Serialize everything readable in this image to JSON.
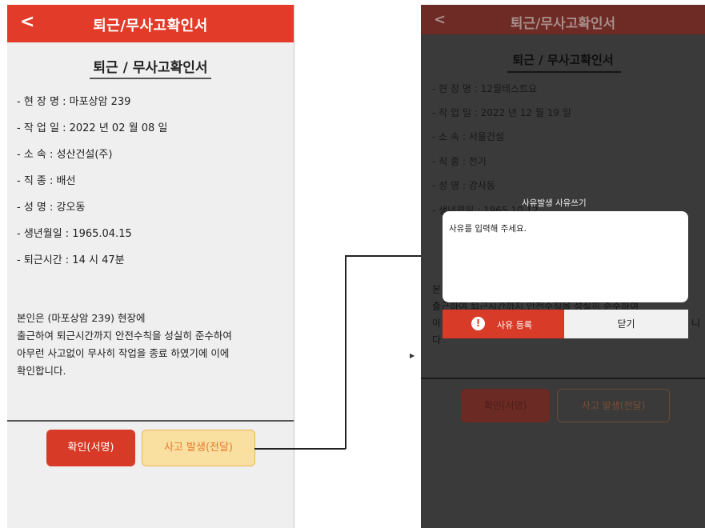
{
  "left_screen": {
    "header": {
      "back_icon": "<",
      "title": "퇴근/무사고확인서"
    },
    "document_title": "퇴근 / 무사고확인서",
    "fields": [
      "- 현  장  명 : 마포상암 239",
      "- 작  업  일 : 2022 년 02 월 08 일",
      "- 소      속 : 성산건설(주)",
      "- 직      종 : 배선",
      "- 성      명 : 강오동",
      "- 생년월일 : 1965.04.15",
      "- 퇴근시간 : 14 시  47분"
    ],
    "paragraph": [
      "본인은 (마포상암 239) 현장에",
      "출근하여 퇴근시간까지 안전수칙을 성실히 준수하여",
      "아무런 사고없이 무사히 작업을 종료 하였기에 이에",
      "확인합니다."
    ],
    "buttons": {
      "confirm": "확인(서명)",
      "accident": "사고 발생(전달)"
    }
  },
  "right_screen": {
    "header": {
      "back_icon": "<",
      "title": "퇴근/무사고확인서"
    },
    "document_title": "퇴근 / 무사고확인서",
    "fields": [
      "- 현  장  명 : 12월테스트요",
      "- 작  업  일 : 2022 년 12 월 19 일",
      "- 소      속 : 서울건설",
      "- 직      종 : 전기",
      "- 성      명 : 강사동",
      "- 생년월일 : 1965.10.12"
    ],
    "paragraph": [
      "본",
      "출근하여 퇴근시간까지 안전수칙을 성실히 준수하여",
      "아",
      "다"
    ],
    "paragraph_tail": "니",
    "buttons": {
      "confirm": "확인(서명)",
      "accident": "사고 발생(전달)"
    },
    "dialog": {
      "title": "사유발생 사유쓰기",
      "input_placeholder": "사유를 입력해 주세요.",
      "register_button": "사유 등록",
      "register_icon": "!",
      "close_button": "닫기"
    }
  },
  "colors": {
    "header_red": "#e23b2a",
    "confirm_red": "#d83a28",
    "accident_fill": "#f9dfa0",
    "accident_text": "#e87a2c",
    "overlay_bg": "#3a3a3a"
  }
}
